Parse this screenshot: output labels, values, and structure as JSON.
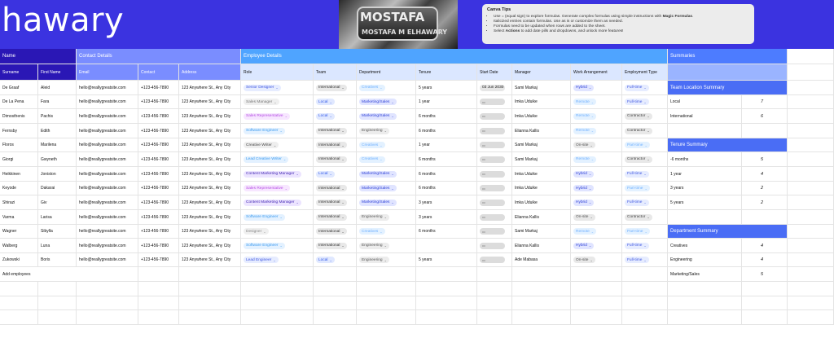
{
  "header": {
    "title": "hawary",
    "logo_line1": "MOSTAFA",
    "logo_line2": "MOSTAFA M ELHAWARY"
  },
  "tips": {
    "title": "Canva Tips",
    "items": [
      [
        "Use = (equal sign) to explore formulas. Generate complex formulas using simple instructions with ",
        "Magic Formulas",
        "."
      ],
      [
        "Italicized entries contain formulas. Use as is or customize them as needed.",
        "",
        ""
      ],
      [
        "Formulas need to be updated when rows are added to the sheet.",
        "",
        ""
      ],
      [
        "Select ",
        "Actions",
        " to add date pills and dropdowns, and unlock more features!"
      ]
    ]
  },
  "sections": {
    "name": "Name",
    "contact": "Contact Details",
    "employee": "Employee Details",
    "summaries": "Summaries"
  },
  "columns": [
    "Surname",
    "First Name",
    "Email",
    "Contact",
    "Address",
    "Role",
    "Team",
    "Department",
    "Tenure",
    "Start Date",
    "Manager",
    "Work Arrangement",
    "Employment Type"
  ],
  "rows": [
    {
      "surname": "De Graaf",
      "first": "Aleid",
      "email": "hello@reallygreatsite.com",
      "contact": "+123-456-7890",
      "address": "123 Anywhere St., Any City",
      "role": "Senior Designer",
      "team": "International",
      "dept": "Creatives",
      "tenure": "5 years",
      "start": "03 Jun 2030",
      "manager": "Sami Markaj",
      "work": "Hybrid",
      "emp": "Full-time"
    },
    {
      "surname": "De La Pena",
      "first": "Fara",
      "email": "hello@reallygreatsite.com",
      "contact": "+123-456-7890",
      "address": "123 Anywhere St., Any City",
      "role": "Sales Manager",
      "team": "Local",
      "dept": "Marketing/Sales",
      "tenure": "1 year",
      "start": "",
      "manager": "Imka Uduike",
      "work": "Remote",
      "emp": "Full-time"
    },
    {
      "surname": "Dimosthenis",
      "first": "Pachis",
      "email": "hello@reallygreatsite.com",
      "contact": "+123-456-7890",
      "address": "123 Anywhere St., Any City",
      "role": "Sales Representative",
      "team": "Local",
      "dept": "Marketing/Sales",
      "tenure": "6 months",
      "start": "",
      "manager": "Imka Uduike",
      "work": "Remote",
      "emp": "Contractor"
    },
    {
      "surname": "Fernsby",
      "first": "Edith",
      "email": "hello@reallygreatsite.com",
      "contact": "+123-456-7890",
      "address": "123 Anywhere St., Any City",
      "role": "Software Engineer",
      "team": "International",
      "dept": "Engineering",
      "tenure": "6 months",
      "start": "",
      "manager": "Elianna Kallis",
      "work": "Remote",
      "emp": "Contractor"
    },
    {
      "surname": "Floros",
      "first": "Marilena",
      "email": "hello@reallygreatsite.com",
      "contact": "+123-456-7890",
      "address": "123 Anywhere St., Any City",
      "role": "Creative Writer",
      "team": "International",
      "dept": "Creatives",
      "tenure": "1 year",
      "start": "",
      "manager": "Sami Markaj",
      "work": "On-site",
      "emp": "Part-time"
    },
    {
      "surname": "Giorgi",
      "first": "Gwyneth",
      "email": "hello@reallygreatsite.com",
      "contact": "+123-456-7890",
      "address": "123 Anywhere St., Any City",
      "role": "Lead Creative Writer",
      "team": "International",
      "dept": "Creatives",
      "tenure": "6 months",
      "start": "",
      "manager": "Sami Markaj",
      "work": "Remote",
      "emp": "Contractor"
    },
    {
      "surname": "Heikkinen",
      "first": "Joniston",
      "email": "hello@reallygreatsite.com",
      "contact": "+123-456-7890",
      "address": "123 Anywhere St., Any City",
      "role": "Content Marketing Manager",
      "team": "Local",
      "dept": "Marketing/Sales",
      "tenure": "6 months",
      "start": "",
      "manager": "Imka Uduike",
      "work": "Hybrid",
      "emp": "Full-time"
    },
    {
      "surname": "Keyode",
      "first": "Dakarai",
      "email": "hello@reallygreatsite.com",
      "contact": "+123-456-7890",
      "address": "123 Anywhere St., Any City",
      "role": "Sales Representative",
      "team": "International",
      "dept": "Marketing/Sales",
      "tenure": "6 months",
      "start": "",
      "manager": "Imka Uduike",
      "work": "Hybrid",
      "emp": "Part-time"
    },
    {
      "surname": "Shirazi",
      "first": "Giv",
      "email": "hello@reallygreatsite.com",
      "contact": "+123-456-7890",
      "address": "123 Anywhere St., Any City",
      "role": "Content Marketing Manager",
      "team": "International",
      "dept": "Marketing/Sales",
      "tenure": "3 years",
      "start": "",
      "manager": "Imka Uduike",
      "work": "Hybrid",
      "emp": "Full-time"
    },
    {
      "surname": "Varma",
      "first": "Larisa",
      "email": "hello@reallygreatsite.com",
      "contact": "+123-456-7890",
      "address": "123 Anywhere St., Any City",
      "role": "Software Engineer",
      "team": "International",
      "dept": "Engineering",
      "tenure": "3 years",
      "start": "",
      "manager": "Elianna Kallis",
      "work": "On-site",
      "emp": "Contractor"
    },
    {
      "surname": "Wagner",
      "first": "Sibylla",
      "email": "hello@reallygreatsite.com",
      "contact": "+123-456-7890",
      "address": "123 Anywhere St., Any City",
      "role": "Designer",
      "team": "International",
      "dept": "Creatives",
      "tenure": "6 months",
      "start": "",
      "manager": "Sami Markaj",
      "work": "Remote",
      "emp": "Part-time"
    },
    {
      "surname": "Walberg",
      "first": "Luna",
      "email": "hello@reallygreatsite.com",
      "contact": "+123-456-7890",
      "address": "123 Anywhere St., Any City",
      "role": "Software Engineer",
      "team": "International",
      "dept": "Engineering",
      "tenure": "",
      "start": "",
      "manager": "Elianna Kallis",
      "work": "Hybrid",
      "emp": "Full-time"
    },
    {
      "surname": "Zukowski",
      "first": "Boris",
      "email": "hello@reallygreatsite.com",
      "contact": "+123-456-7890",
      "address": "123 Anywhere St., Any City",
      "role": "Lead Engineer",
      "team": "Local",
      "dept": "Engineering",
      "tenure": "5 years",
      "start": "",
      "manager": "Ade Mabasa",
      "work": "On-site",
      "emp": "Full-time"
    }
  ],
  "add_label": "Add employees",
  "summaries": [
    {
      "row": 0,
      "header": "Team Location Summary"
    },
    {
      "row": 1,
      "label": "Local",
      "value": "7"
    },
    {
      "row": 2,
      "label": "International",
      "value": "6"
    },
    {
      "row": 4,
      "header": "Tenure Summary"
    },
    {
      "row": 5,
      "label": "-6 months",
      "value": "5"
    },
    {
      "row": 6,
      "label": "1 year",
      "value": "4"
    },
    {
      "row": 7,
      "label": "3 years",
      "value": "2"
    },
    {
      "row": 8,
      "label": "5 years",
      "value": "2"
    },
    {
      "row": 10,
      "header": "Department Summary"
    },
    {
      "row": 11,
      "label": "Creatives",
      "value": "4"
    },
    {
      "row": 12,
      "label": "Engineering",
      "value": "4"
    },
    {
      "row": 13,
      "label": "Marketing/Sales",
      "value": "5"
    }
  ],
  "colors": {
    "header_bg": "#3b33e0",
    "name_section": "#2a17b5",
    "contact_section": "#7a8dff",
    "employee_section": "#4fa4ff",
    "summaries_section": "#4d7cff",
    "column_header_bg": "#dbe7ff",
    "summary_header_bg": "#4a6df5"
  },
  "pill_styles": {
    "role": {
      "Senior Designer": [
        "#e6ecff",
        "#3d55e0"
      ],
      "Sales Manager": [
        "#efefef",
        "#777777"
      ],
      "Sales Representative": [
        "#f7e6ff",
        "#b44ae3"
      ],
      "Software Engineer": [
        "#e3f1ff",
        "#3b9aef"
      ],
      "Creative Writer": [
        "#eeeeee",
        "#444444"
      ],
      "Lead Creative Writer": [
        "#e3f1ff",
        "#3b9aef"
      ],
      "Content Marketing Manager": [
        "#ece4ff",
        "#3c1fb0"
      ],
      "Designer": [
        "#efefef",
        "#888888"
      ],
      "Lead Engineer": [
        "#e6ecff",
        "#3d55e0"
      ]
    },
    "team": {
      "International": [
        "#e8e8e8",
        "#333333"
      ],
      "Local": [
        "#e0e8ff",
        "#2f56e8"
      ]
    },
    "dept": {
      "Creatives": [
        "#e3f1ff",
        "#6fb0ff"
      ],
      "Marketing/Sales": [
        "#e0e4ff",
        "#2c3fd6"
      ],
      "Engineering": [
        "#ececec",
        "#555555"
      ]
    },
    "work": {
      "Hybrid": [
        "#e0e4ff",
        "#2c3fd6"
      ],
      "Remote": [
        "#e3f1ff",
        "#6fb0ff"
      ],
      "On-site": [
        "#e8e8e8",
        "#555555"
      ]
    },
    "emp": {
      "Full-time": [
        "#e6ecff",
        "#3d55e0"
      ],
      "Contractor": [
        "#e8e8e8",
        "#444444"
      ],
      "Part-time": [
        "#e3f1ff",
        "#6fb0ff"
      ]
    }
  }
}
